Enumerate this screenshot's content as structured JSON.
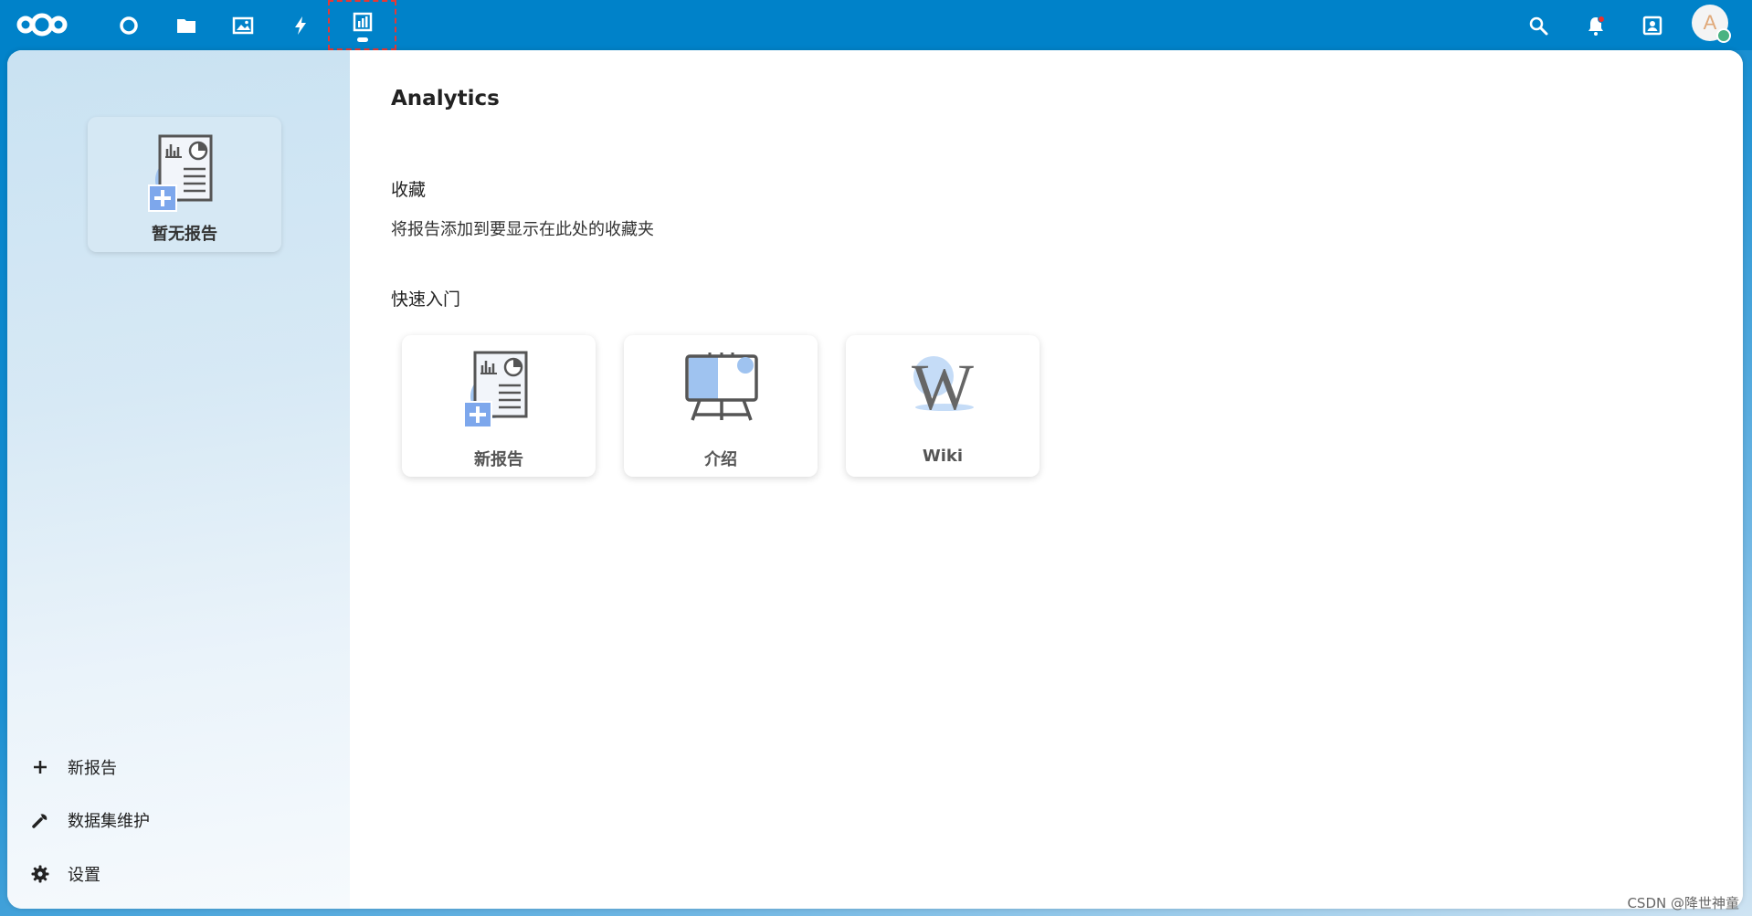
{
  "header": {
    "apps": [
      {
        "name": "dashboard-app",
        "icon": "circle-icon"
      },
      {
        "name": "files-app",
        "icon": "folder-icon"
      },
      {
        "name": "photos-app",
        "icon": "image-icon"
      },
      {
        "name": "activity-app",
        "icon": "lightning-icon"
      },
      {
        "name": "analytics-app",
        "icon": "bar-chart-icon",
        "active": true
      }
    ],
    "right_icons": [
      "search-icon",
      "bell-icon",
      "contacts-icon"
    ],
    "avatar_initial": "A",
    "accent_color": "#0082c9"
  },
  "sidebar": {
    "card_label": "暂无报告",
    "items": [
      {
        "label": "新报告",
        "icon": "plus-icon"
      },
      {
        "label": "数据集维护",
        "icon": "wrench-icon"
      },
      {
        "label": "设置",
        "icon": "gear-icon"
      }
    ]
  },
  "main": {
    "title": "Analytics",
    "favorites": {
      "title": "收藏",
      "description": "将报告添加到要显示在此处的收藏夹"
    },
    "quickstart": {
      "title": "快速入门",
      "cards": [
        {
          "label": "新报告",
          "icon": "new-report-icon"
        },
        {
          "label": "介绍",
          "icon": "presentation-icon"
        },
        {
          "label": "Wiki",
          "icon": "wikipedia-icon"
        }
      ]
    }
  },
  "watermark": "CSDN @降世神童"
}
